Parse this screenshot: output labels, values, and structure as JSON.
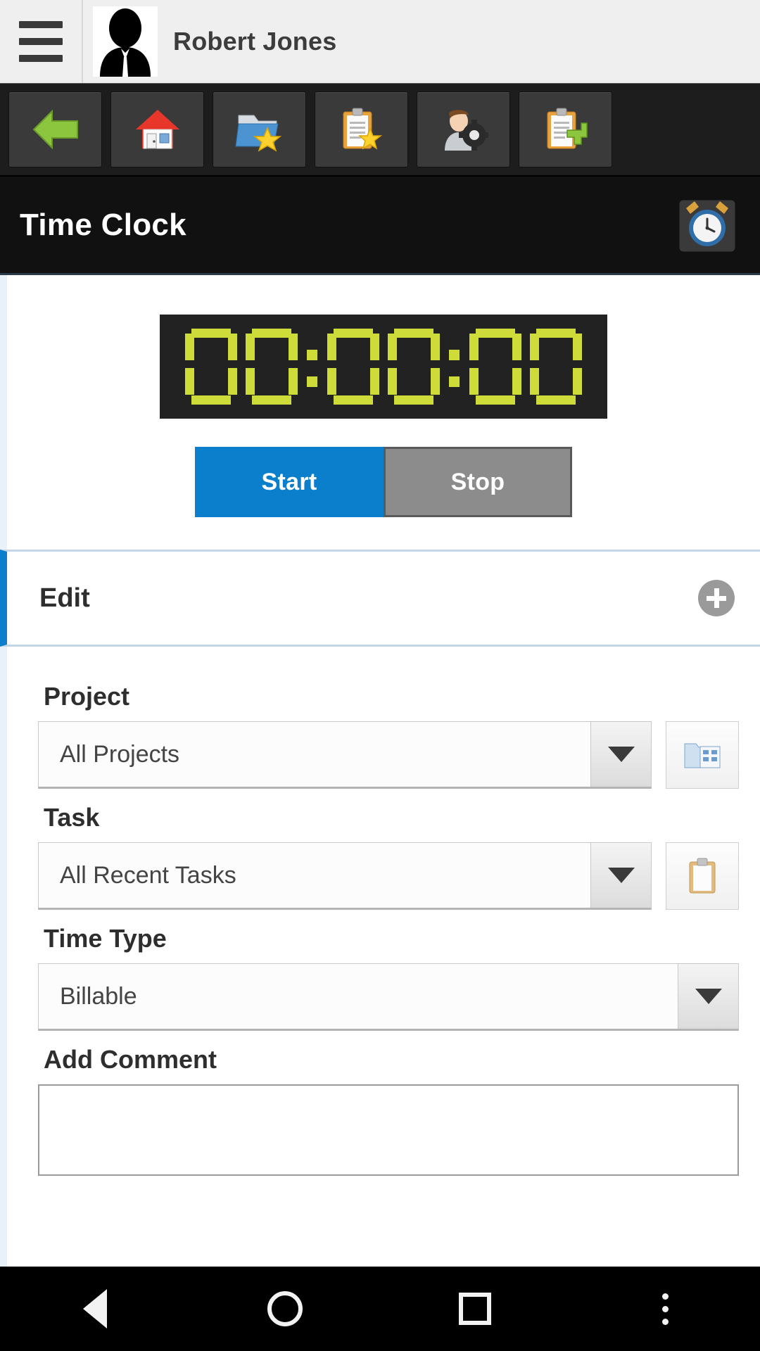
{
  "header": {
    "menu_icon": "hamburger-menu-icon",
    "avatar_icon": "user-avatar-silhouette",
    "user_name": "Robert Jones"
  },
  "toolbar": {
    "buttons": [
      {
        "name": "back-button",
        "icon": "green-left-arrow-icon"
      },
      {
        "name": "home-button",
        "icon": "house-icon"
      },
      {
        "name": "favorite-projects-button",
        "icon": "folder-star-icon"
      },
      {
        "name": "favorite-tasks-button",
        "icon": "clipboard-star-icon"
      },
      {
        "name": "user-settings-button",
        "icon": "person-gear-icon"
      },
      {
        "name": "new-task-button",
        "icon": "clipboard-plus-icon"
      }
    ]
  },
  "page": {
    "title": "Time Clock",
    "title_icon": "alarm-clock-icon"
  },
  "timer": {
    "display": "00:00:00",
    "digits": [
      "0",
      "0",
      "0",
      "0",
      "0",
      "0"
    ],
    "start_label": "Start",
    "stop_label": "Stop",
    "lcd_color": "#cddc39",
    "lcd_background": "#222222",
    "start_color": "#0b7fcc",
    "stop_color": "#8c8c8c"
  },
  "edit_section": {
    "title": "Edit",
    "add_icon": "plus-circle-icon",
    "accent_color": "#0b7fcc"
  },
  "form": {
    "project": {
      "label": "Project",
      "value": "All Projects",
      "dropdown_icon": "chevron-down-icon",
      "side_button_icon": "folder-browse-icon"
    },
    "task": {
      "label": "Task",
      "value": "All Recent Tasks",
      "dropdown_icon": "chevron-down-icon",
      "side_button_icon": "clipboard-browse-icon"
    },
    "time_type": {
      "label": "Time Type",
      "value": "Billable",
      "dropdown_icon": "chevron-down-icon"
    },
    "comment": {
      "label": "Add Comment",
      "value": "",
      "placeholder": ""
    }
  },
  "navbar": {
    "back_icon": "triangle-back-icon",
    "home_icon": "circle-home-icon",
    "recents_icon": "square-recents-icon",
    "overflow_icon": "three-dots-menu-icon"
  }
}
